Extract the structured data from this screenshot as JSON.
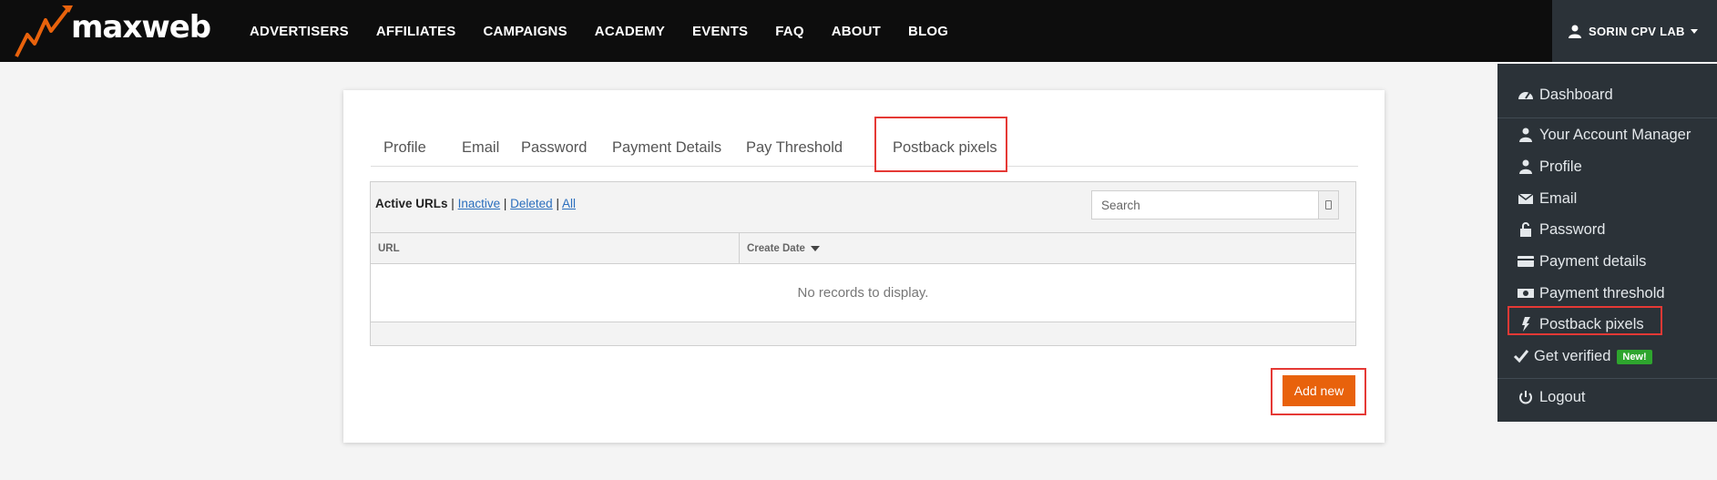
{
  "brand": {
    "logo_text_prefix": "max",
    "logo_text_suffix": "web",
    "logo_accent_color": "#e8620c"
  },
  "nav": {
    "items": [
      {
        "label": "ADVERTISERS"
      },
      {
        "label": "AFFILIATES"
      },
      {
        "label": "CAMPAIGNS"
      },
      {
        "label": "ACADEMY"
      },
      {
        "label": "EVENTS"
      },
      {
        "label": "FAQ"
      },
      {
        "label": "ABOUT"
      },
      {
        "label": "BLOG"
      }
    ],
    "user_label": "SORIN CPV LAB"
  },
  "dropdown": {
    "dashboard": "Dashboard",
    "account_manager": "Your Account Manager",
    "profile": "Profile",
    "email": "Email",
    "password": "Password",
    "payment_details": "Payment details",
    "payment_threshold": "Payment threshold",
    "postback_pixels": "Postback pixels",
    "get_verified": "Get verified",
    "new_badge": "New!",
    "logout": "Logout"
  },
  "tabs": {
    "profile": "Profile",
    "email": "Email",
    "password": "Password",
    "payment_details": "Payment Details",
    "pay_threshold": "Pay Threshold",
    "postback_pixels": "Postback pixels",
    "active": "Postback pixels"
  },
  "grid": {
    "filter_active": "Active URLs",
    "sep": "|",
    "filter_inactive": "Inactive",
    "filter_deleted": "Deleted",
    "filter_all": "All",
    "search_placeholder": "Search",
    "columns": {
      "url": "URL",
      "create_date": "Create Date"
    },
    "empty_message": "No records to display."
  },
  "actions": {
    "add_new": "Add new"
  },
  "colors": {
    "topbar_bg": "#0d0d0d",
    "dropdown_bg": "#2b3238",
    "accent_orange": "#e8620c",
    "highlight_red": "#e53935",
    "badge_green": "#2ea52e",
    "link_blue": "#2a6ebd"
  }
}
